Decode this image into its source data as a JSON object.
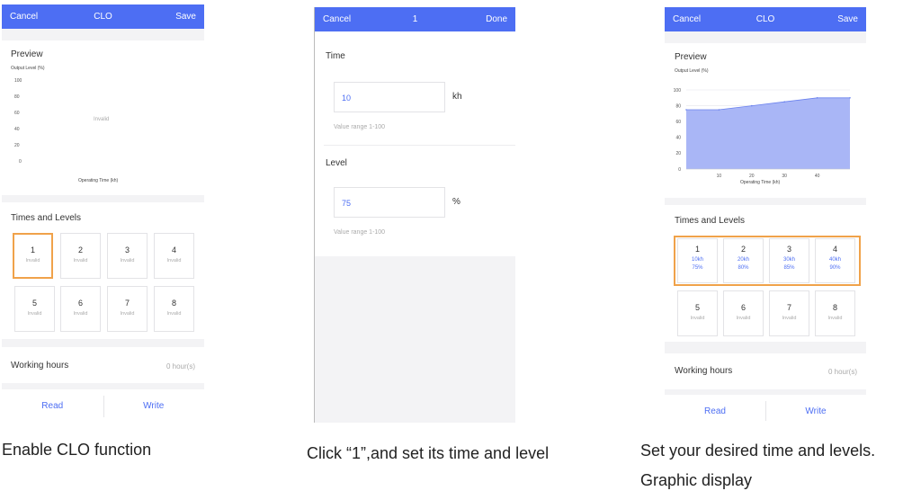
{
  "screen1": {
    "nav": {
      "left": "Cancel",
      "title": "CLO",
      "right": "Save"
    },
    "preview_title": "Preview",
    "y_axis_label": "Output Level (%)",
    "y_ticks": [
      "100",
      "80",
      "60",
      "40",
      "20",
      "0"
    ],
    "chart_message": "Invalid",
    "x_axis_label": "Operating Time (kh)",
    "times_title": "Times and Levels",
    "tiles": [
      {
        "num": "1",
        "status": "Invalid"
      },
      {
        "num": "2",
        "status": "Invalid"
      },
      {
        "num": "3",
        "status": "Invalid"
      },
      {
        "num": "4",
        "status": "Invalid"
      },
      {
        "num": "5",
        "status": "Invalid"
      },
      {
        "num": "6",
        "status": "Invalid"
      },
      {
        "num": "7",
        "status": "Invalid"
      },
      {
        "num": "8",
        "status": "Invalid"
      }
    ],
    "working_hours_label": "Working hours",
    "working_hours_value": "0 hour(s)",
    "read_label": "Read",
    "write_label": "Write"
  },
  "screen2": {
    "nav": {
      "left": "Cancel",
      "title": "1",
      "right": "Done"
    },
    "time_label": "Time",
    "time_value": "10",
    "time_unit": "kh",
    "time_hint": "Value range 1-100",
    "level_label": "Level",
    "level_value": "75",
    "level_unit": "%",
    "level_hint": "Value range 1-100"
  },
  "screen3": {
    "nav": {
      "left": "Cancel",
      "title": "CLO",
      "right": "Save"
    },
    "preview_title": "Preview",
    "y_axis_label": "Output Level (%)",
    "y_ticks": [
      "100",
      "80",
      "60",
      "40",
      "20",
      "0"
    ],
    "x_ticks": [
      "10",
      "20",
      "30",
      "40"
    ],
    "x_axis_label": "Operating Time (kh)",
    "times_title": "Times and Levels",
    "tiles": [
      {
        "num": "1",
        "time": "10kh",
        "level": "75%"
      },
      {
        "num": "2",
        "time": "20kh",
        "level": "80%"
      },
      {
        "num": "3",
        "time": "30kh",
        "level": "85%"
      },
      {
        "num": "4",
        "time": "40kh",
        "level": "90%"
      },
      {
        "num": "5",
        "status": "Invalid"
      },
      {
        "num": "6",
        "status": "Invalid"
      },
      {
        "num": "7",
        "status": "Invalid"
      },
      {
        "num": "8",
        "status": "Invalid"
      }
    ],
    "working_hours_label": "Working hours",
    "working_hours_value": "0 hour(s)",
    "read_label": "Read",
    "write_label": "Write"
  },
  "captions": {
    "step1": "Enable CLO function",
    "step2": "Click “1”,and set its time and level",
    "step3_line1": "Set your desired time and levels.",
    "step3_line2": "Graphic display"
  },
  "colors": {
    "accent": "#4d6ef3",
    "highlight": "#f0a24a",
    "background": "#f3f3f5"
  },
  "chart_data": {
    "type": "area",
    "x": [
      0,
      10,
      20,
      30,
      40,
      50
    ],
    "values": [
      75,
      75,
      80,
      85,
      90,
      90
    ],
    "xlabel": "Operating Time (kh)",
    "ylabel": "Output Level (%)",
    "ylim": [
      0,
      100
    ],
    "y_ticks": [
      0,
      20,
      40,
      60,
      80,
      100
    ],
    "x_ticks": [
      10,
      20,
      30,
      40
    ],
    "grid": true
  }
}
